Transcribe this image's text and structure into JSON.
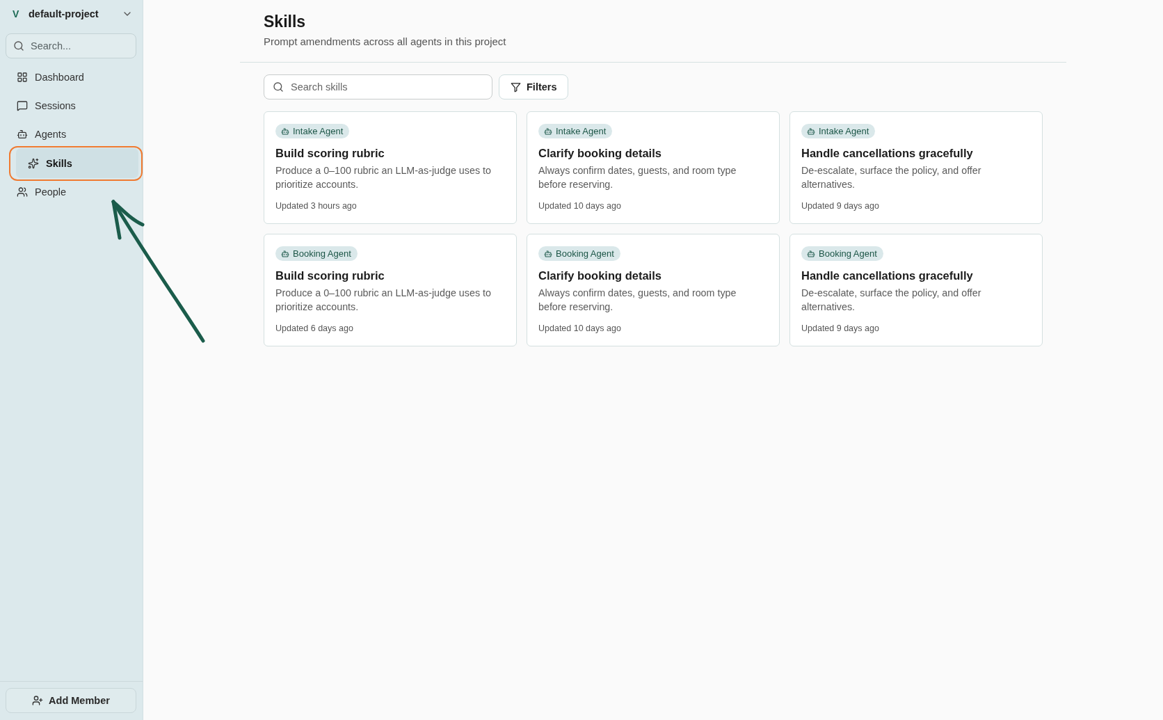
{
  "sidebar": {
    "project": {
      "initial": "V",
      "name": "default-project"
    },
    "search": {
      "placeholder": "Search..."
    },
    "nav": [
      {
        "kind": "dashboard",
        "label": "Dashboard",
        "selected": false,
        "outlined": false
      },
      {
        "kind": "sessions",
        "label": "Sessions",
        "selected": false,
        "outlined": false
      },
      {
        "kind": "agents",
        "label": "Agents",
        "selected": false,
        "outlined": false
      },
      {
        "kind": "skills",
        "label": "Skills",
        "selected": true,
        "outlined": true
      },
      {
        "kind": "people",
        "label": "People",
        "selected": false,
        "outlined": false
      }
    ],
    "footer_button": "Add Member"
  },
  "header": {
    "title": "Skills",
    "subtitle": "Prompt amendments across all agents in this project"
  },
  "toolbar": {
    "search": {
      "placeholder": "Search skills"
    },
    "filters_button": "Filters"
  },
  "cards": [
    {
      "agent": "Intake Agent",
      "title": "Build scoring rubric",
      "description": "Produce a 0–100 rubric an LLM-as-judge uses to prioritize accounts.",
      "updated": "Updated 3 hours ago"
    },
    {
      "agent": "Intake Agent",
      "title": "Clarify booking details",
      "description": "Always confirm dates, guests, and room type before reserving.",
      "updated": "Updated 10 days ago"
    },
    {
      "agent": "Intake Agent",
      "title": "Handle cancellations gracefully",
      "description": "De-escalate, surface the policy, and offer alternatives.",
      "updated": "Updated 9 days ago"
    },
    {
      "agent": "Booking Agent",
      "title": "Build scoring rubric",
      "description": "Produce a 0–100 rubric an LLM-as-judge uses to prioritize accounts.",
      "updated": "Updated 6 days ago"
    },
    {
      "agent": "Booking Agent",
      "title": "Clarify booking details",
      "description": "Always confirm dates, guests, and room type before reserving.",
      "updated": "Updated 10 days ago"
    },
    {
      "agent": "Booking Agent",
      "title": "Handle cancellations gracefully",
      "description": "De-escalate, surface the policy, and offer alternatives.",
      "updated": "Updated 9 days ago"
    }
  ],
  "annotations": [
    {
      "kind": "arrow"
    }
  ]
}
